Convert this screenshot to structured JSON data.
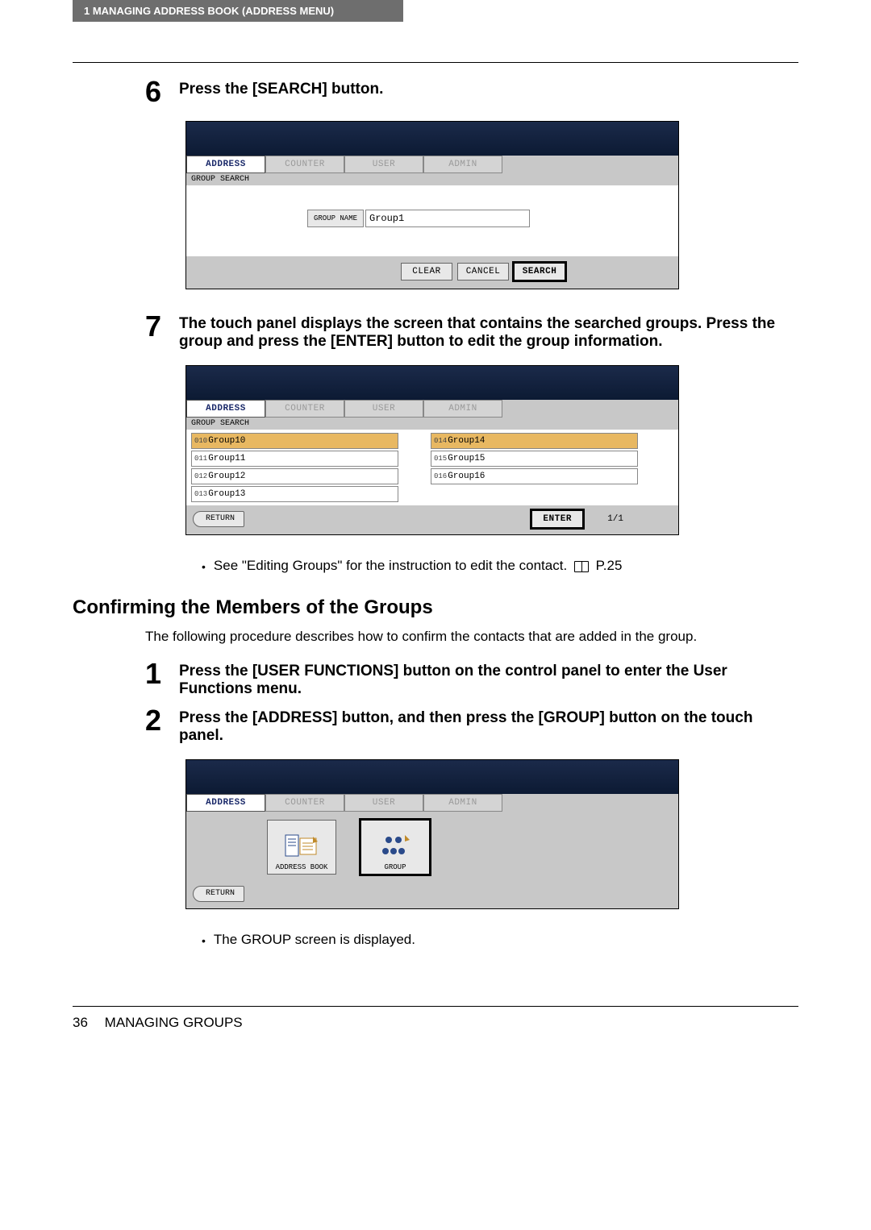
{
  "header": {
    "chapter": "1   MANAGING ADDRESS BOOK (ADDRESS MENU)"
  },
  "steps": {
    "s6": {
      "num": "6",
      "text": "Press the [SEARCH] button."
    },
    "s7": {
      "num": "7",
      "text": "The touch panel displays the screen that contains the searched groups.  Press the group and press the [ENTER] button to edit the group information."
    },
    "s1": {
      "num": "1",
      "text": "Press the [USER FUNCTIONS] button on the control panel to enter the User Functions menu."
    },
    "s2": {
      "num": "2",
      "text": "Press the [ADDRESS] button, and then press the [GROUP] button on the touch panel."
    }
  },
  "tabs": {
    "address": "ADDRESS",
    "counter": "COUNTER",
    "user": "USER",
    "admin": "ADMIN"
  },
  "labels": {
    "group_search": "GROUP SEARCH",
    "group_name_btn": "GROUP NAME",
    "clear": "CLEAR",
    "cancel": "CANCEL",
    "search": "SEARCH",
    "return": "RETURN",
    "enter": "ENTER",
    "page": "1/1",
    "address_book_btn": "ADDRESS BOOK",
    "group_btn": "GROUP"
  },
  "fields": {
    "group_name_value": "Group1"
  },
  "results": {
    "left": [
      {
        "num": "010",
        "name": "Group10",
        "sel": true
      },
      {
        "num": "011",
        "name": "Group11",
        "sel": false
      },
      {
        "num": "012",
        "name": "Group12",
        "sel": false
      },
      {
        "num": "013",
        "name": "Group13",
        "sel": false
      }
    ],
    "right": [
      {
        "num": "014",
        "name": "Group14",
        "sel": true
      },
      {
        "num": "015",
        "name": "Group15",
        "sel": false
      },
      {
        "num": "016",
        "name": "Group16",
        "sel": false
      },
      {
        "num": "",
        "name": "",
        "blank": true
      }
    ]
  },
  "notes": {
    "n1": "See \"Editing Groups\" for the instruction to edit the contact.",
    "n1_page": "P.25",
    "n2": "The GROUP screen is displayed."
  },
  "section2": {
    "title": "Confirming the Members of the Groups",
    "intro": "The following procedure describes how to confirm the contacts that are added in the group."
  },
  "footer": {
    "page_num": "36",
    "title": "MANAGING GROUPS"
  }
}
